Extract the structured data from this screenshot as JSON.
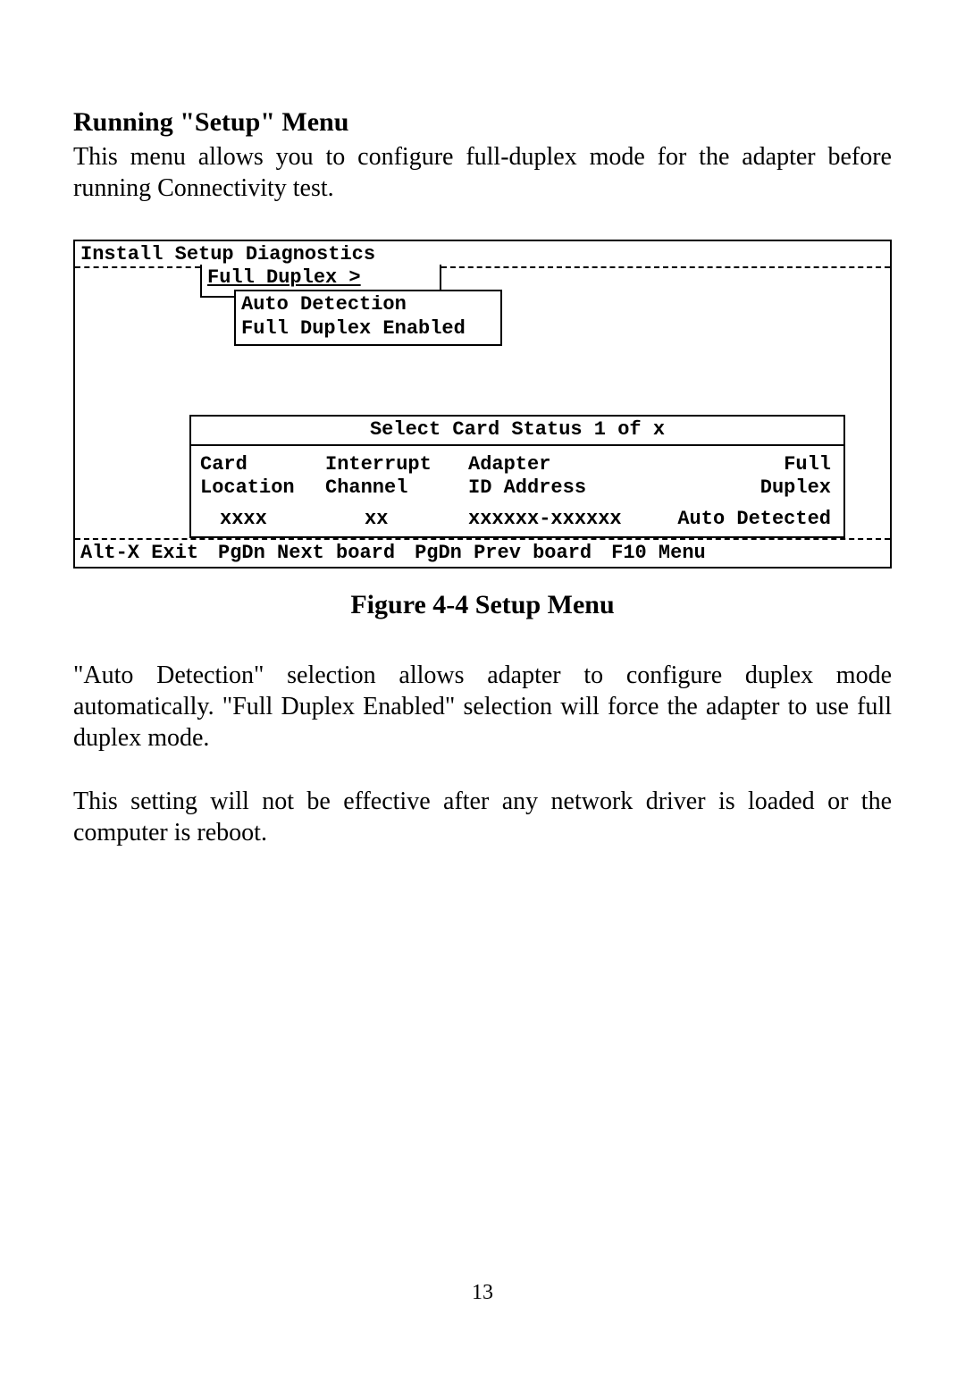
{
  "heading": "Running \"Setup\" Menu",
  "intro_para": "This menu allows you to configure full-duplex mode for the adapter before running Connectivity test.",
  "terminal": {
    "menu_bar": {
      "install": "Install",
      "setup": "Setup",
      "diagnostics": "Diagnostics"
    },
    "dropdown": {
      "label": "Full Duplex >",
      "options": {
        "auto": "Auto Detection",
        "full": "Full Duplex Enabled"
      }
    },
    "status": {
      "title": "Select Card Status 1 of x",
      "columns": {
        "col1_l1": "Card",
        "col1_l2": "Location",
        "col2_l1": "Interrupt",
        "col2_l2": "Channel",
        "col3_l1": "Adapter",
        "col3_l2": "ID Address",
        "col4_l1": "Full",
        "col4_l2": "Duplex"
      },
      "row": {
        "loc": "xxxx",
        "chan": "xx",
        "addr": "xxxxxx-xxxxxx",
        "duplex": "Auto Detected"
      }
    },
    "footer": {
      "f1": "Alt-X Exit",
      "f2": "PgDn Next board",
      "f3": "PgDn Prev board",
      "f4": "F10 Menu"
    }
  },
  "figure_caption": "Figure 4-4 Setup Menu",
  "para2": "\"Auto Detection\" selection allows adapter to configure duplex mode automatically. \"Full Duplex Enabled\" selection will force the adapter to use full duplex mode.",
  "para3": "This setting will not be effective after any network driver is loaded or the computer is reboot.",
  "page_number": "13"
}
